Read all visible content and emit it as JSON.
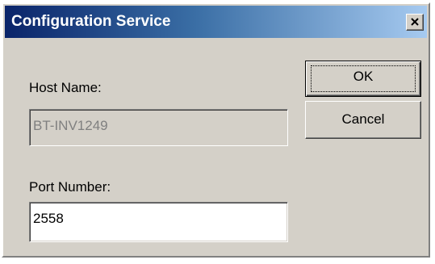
{
  "window": {
    "title": "Configuration Service",
    "close_icon": "close-x-icon"
  },
  "form": {
    "host_label": "Host Name:",
    "host_value": "BT-INV1249",
    "port_label": "Port Number:",
    "port_value": "2558"
  },
  "buttons": {
    "ok_label": "OK",
    "cancel_label": "Cancel"
  },
  "colors": {
    "title_gradient_start": "#0a246a",
    "title_gradient_end": "#a6caf0",
    "face": "#d4d0c8"
  }
}
